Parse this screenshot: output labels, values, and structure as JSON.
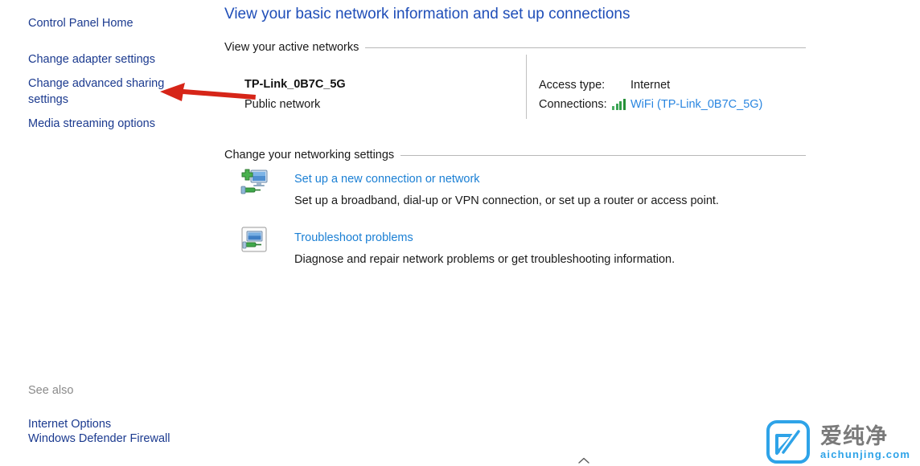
{
  "sidebar": {
    "home_label": "Control Panel Home",
    "links": [
      {
        "label": "Change adapter settings"
      },
      {
        "label": "Change advanced sharing settings"
      },
      {
        "label": "Media streaming options"
      }
    ],
    "see_also": {
      "label": "See also",
      "links": [
        {
          "label": "Internet Options"
        },
        {
          "label": "Windows Defender Firewall"
        }
      ]
    }
  },
  "main": {
    "page_title": "View your basic network information and set up connections",
    "sections": {
      "active_networks_header": "View your active networks",
      "change_settings_header": "Change your networking settings"
    },
    "active_network": {
      "name": "TP-Link_0B7C_5G",
      "profile": "Public network",
      "access_type_label": "Access type:",
      "access_type_value": "Internet",
      "connections_label": "Connections:",
      "connections_value": "WiFi (TP-Link_0B7C_5G)",
      "connections_icon": "wifi-signal-bars-icon"
    },
    "tasks": [
      {
        "icon": "new-connection-icon",
        "link": "Set up a new connection or network",
        "description": "Set up a broadband, dial-up or VPN connection, or set up a router or access point."
      },
      {
        "icon": "troubleshoot-icon",
        "link": "Troubleshoot problems",
        "description": "Diagnose and repair network problems or get troubleshooting information."
      }
    ]
  },
  "annotation": {
    "arrow_icon": "red-left-arrow-icon",
    "arrow_color": "#d62518"
  },
  "watermark": {
    "logo_icon": "aichunjing-logo-icon",
    "chinese_text": "爱纯净",
    "site_text": "aichunjing.com",
    "brand_color": "#2ea3e8"
  },
  "bottom_marker": {
    "icon": "chevron-up-icon"
  },
  "colors": {
    "title_blue": "#1f4eb8",
    "sidebar_link": "#1b3a8f",
    "content_link": "#1a7fd4",
    "connection_link": "#2a86e0",
    "muted_text": "#8a8a8a",
    "rule": "#b8b8b8"
  }
}
